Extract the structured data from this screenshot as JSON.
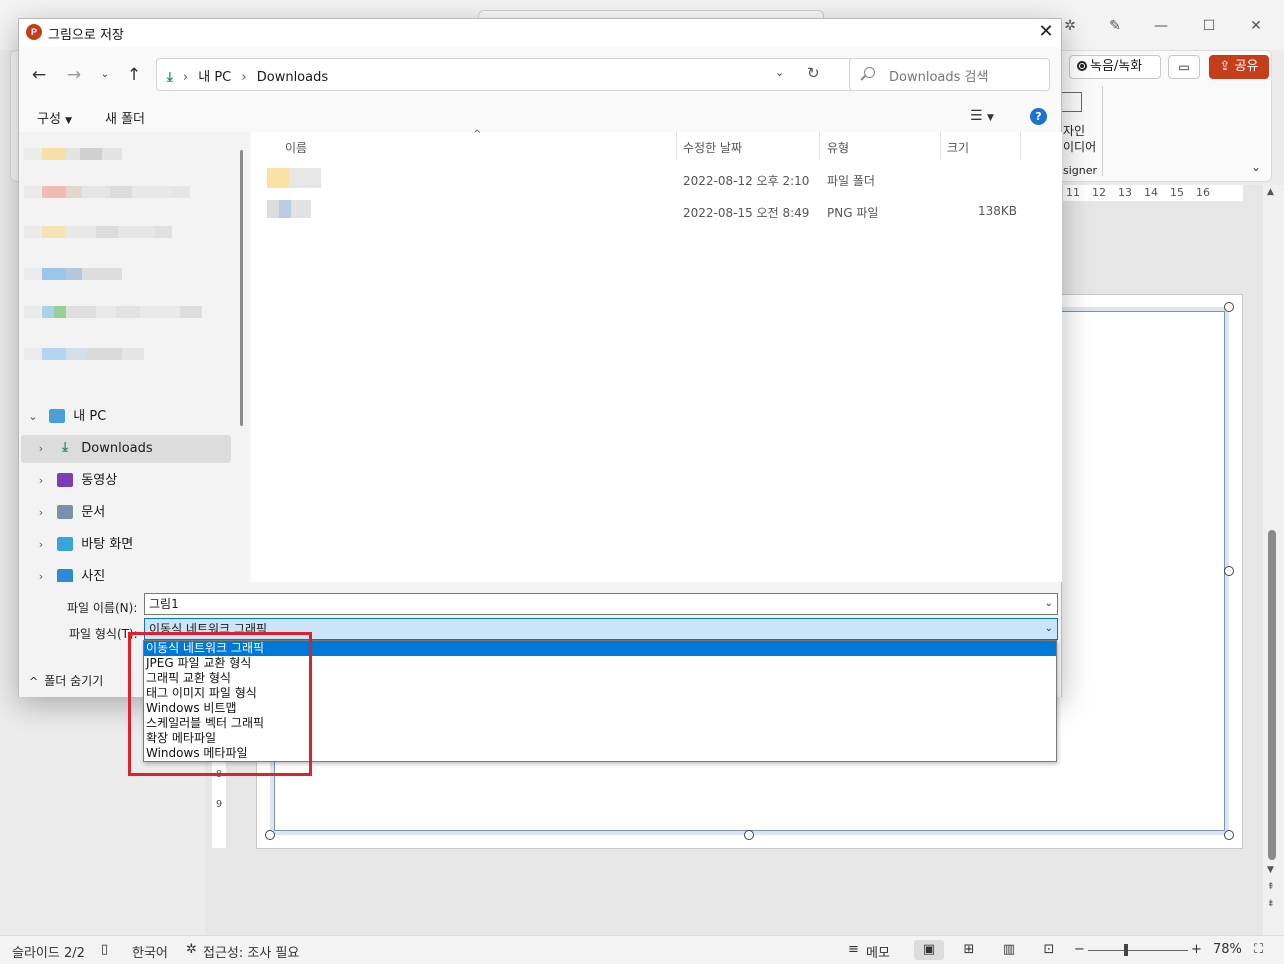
{
  "ppt": {
    "record_label": "녹음/녹화",
    "share_label": "공유",
    "designer_line1": "자인",
    "designer_line2": "이디어",
    "designer_line3": "signer",
    "ruler_ticks": [
      "11",
      "12",
      "13",
      "14",
      "15",
      "16"
    ],
    "vruler": [
      "8",
      "9"
    ],
    "status": {
      "slide": "슬라이드 2/2",
      "language": "한국어",
      "accessibility": "접근성: 조사 필요",
      "notes": "메모",
      "zoom": "78%"
    }
  },
  "dialog": {
    "title": "그림으로 저장",
    "address": {
      "segments": [
        "내 PC",
        "Downloads"
      ]
    },
    "search_placeholder": "Downloads 검색",
    "organize_label": "구성",
    "new_folder_label": "새 폴더",
    "help_glyph": "?",
    "tree": [
      {
        "label": "내 PC",
        "expanded": true,
        "icon": "pc-icon"
      },
      {
        "label": "Downloads",
        "selected": true,
        "icon": "downloads-icon"
      },
      {
        "label": "동영상",
        "icon": "videos-icon"
      },
      {
        "label": "문서",
        "icon": "documents-icon"
      },
      {
        "label": "바탕 화면",
        "icon": "desktop-icon"
      },
      {
        "label": "사진",
        "icon": "pictures-icon"
      }
    ],
    "columns": {
      "name": "이름",
      "modified": "수정한 날짜",
      "type": "유형",
      "size": "크기"
    },
    "files": [
      {
        "modified": "2022-08-12 오후 2:10",
        "type": "파일 폴더",
        "size": ""
      },
      {
        "modified": "2022-08-15 오전 8:49",
        "type": "PNG 파일",
        "size": "138KB"
      }
    ],
    "filename_label": "파일 이름(N):",
    "filename_value": "그림1",
    "filetype_label": "파일 형식(T):",
    "filetype_value": "이동식 네트워크 그래픽",
    "hide_folders_label": "폴더 숨기기",
    "filetype_options": [
      "이동식 네트워크 그래픽",
      "JPEG 파일 교환 형식",
      "그래픽 교환 형식",
      "태그 이미지 파일 형식",
      "Windows 비트맵",
      "스케일러블 벡터 그래픽",
      "확장 메타파일",
      "Windows 메타파일"
    ]
  },
  "colors": {
    "accent": "#0078d7",
    "highlight_box": "#e0202a",
    "ppt_brand": "#c43e1c"
  }
}
